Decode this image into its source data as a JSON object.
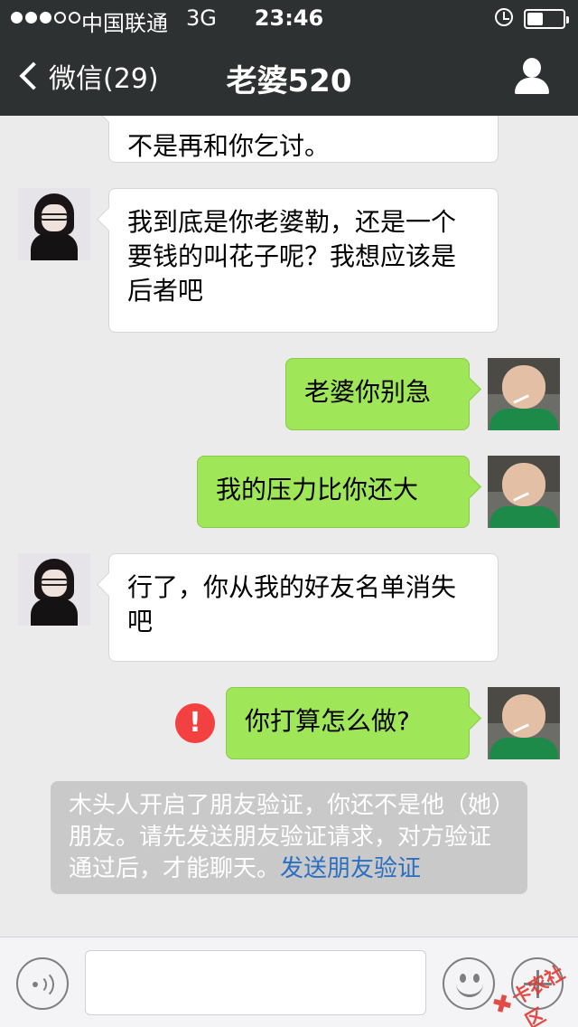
{
  "status_bar": {
    "carrier": "中国联通",
    "network": "3G",
    "time": "23:46",
    "signal_bars": 3,
    "signal_total": 5,
    "battery_level": 0.45
  },
  "nav": {
    "back_label": "微信(29)",
    "title": "老婆520"
  },
  "messages": [
    {
      "from": "her",
      "text": "不是再和你乞讨。"
    },
    {
      "from": "her",
      "text": "我到底是你老婆勒，还是一个要钱的叫花子呢？我想应该是后者吧"
    },
    {
      "from": "me",
      "text": "老婆你别急"
    },
    {
      "from": "me",
      "text": "我的压力比你还大"
    },
    {
      "from": "her",
      "text": "行了，你从我的好友名单消失吧"
    },
    {
      "from": "me",
      "text": "你打算怎么做?",
      "failed": true
    }
  ],
  "error_mark": "!",
  "system_notice": {
    "text": "木头人开启了朋友验证，你还不是他（她）朋友。请先发送朋友验证请求，对方验证通过后，才能聊天。",
    "link": "发送朋友验证"
  },
  "input_bar": {
    "value": "",
    "icons": [
      "voice-icon",
      "emoji-icon",
      "plus-icon"
    ]
  },
  "watermark": {
    "text": "卡农社区"
  },
  "colors": {
    "header_bg": "#2e3132",
    "outgoing_bubble": "#9fe658",
    "incoming_bubble": "#ffffff",
    "chat_bg": "#ebebeb",
    "error_red": "#f34141",
    "link_blue": "#2b6fc2"
  }
}
